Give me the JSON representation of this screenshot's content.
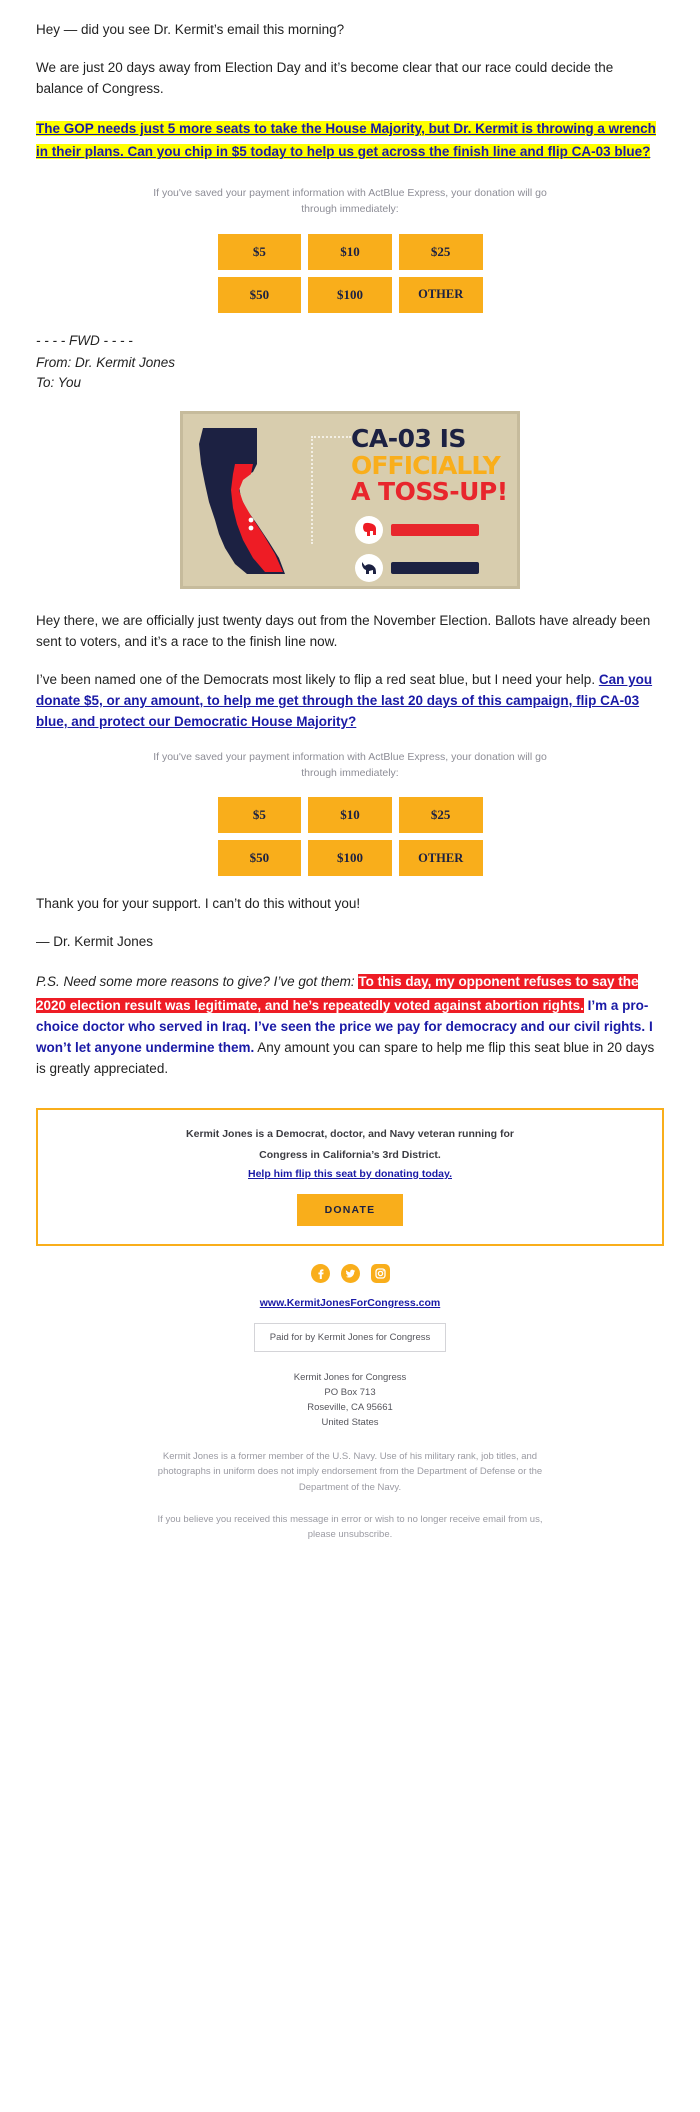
{
  "colors": {
    "highlight_yellow": "#ffff00",
    "link_blue": "#1a1aa6",
    "donate_orange": "#f9ae1b",
    "alert_red": "#ee1c25",
    "navy": "#1c2142",
    "graphic_bg": "#d8cdae"
  },
  "intro": {
    "p1": "Hey — did you see Dr. Kermit’s email this morning?",
    "p2": "We are just 20 days away from Election Day and it’s become clear that our race could decide the balance of Congress.",
    "highlight_link": "The GOP needs just 5 more seats to take the House Majority, but Dr. Kermit is throwing a wrench in their plans. Can you chip in $5 today to help us get across the finish line and flip CA-03 blue?"
  },
  "express_note": "If you've saved your payment information with ActBlue Express, your donation will go through immediately:",
  "donation_buttons": {
    "row1": [
      "$5",
      "$10",
      "$25"
    ],
    "row2": [
      "$50",
      "$100",
      "OTHER"
    ]
  },
  "forward": {
    "divider": "- - - - FWD - - - -",
    "from_label": "From: Dr. Kermit Jones",
    "to_label": "To: You"
  },
  "graphic": {
    "alt_name": "ca-03-toss-up-graphic",
    "line1": "CA-03 IS",
    "line2": "OFFICIALLY",
    "line3": "A TOSS-UP!",
    "party_rep": "republican-elephant-icon",
    "party_dem": "democrat-donkey-icon",
    "bar_rep_label": "Republican",
    "bar_dem_label": "Democrat"
  },
  "fwd_body": {
    "p1": "Hey there, we are officially just twenty days out from the November Election. Ballots have already been sent to voters, and it’s a race to the finish line now.",
    "p2_lead": "I’ve been named one of the Democrats most likely to flip a red seat blue, but I need your help. ",
    "p2_link": "Can you donate $5, or any amount, to help me get through the last 20 days of this campaign, flip CA-03 blue, and protect our Democratic House Majority?",
    "thanks": "Thank you for your support. I can’t do this without you!",
    "signature": "— Dr. Kermit Jones"
  },
  "ps": {
    "lead": "P.S. Need some more reasons to give? I’ve got them: ",
    "red_highlight": "To this day, my opponent refuses to say the 2020 election result was legitimate, and he’s repeatedly voted against abortion rights.",
    "blue_bold": " I’m a pro-choice doctor who served in Iraq. I’ve seen the price we pay for democracy and our civil rights. I won’t let anyone undermine them.",
    "tail": " Any amount you can spare to help me flip this seat blue in 20 days is greatly appreciated."
  },
  "bio_box": {
    "line1": "Kermit Jones is a Democrat, doctor, and Navy veteran running for",
    "line2": "Congress in California’s 3rd District.",
    "link": "Help him flip this seat by donating today.",
    "cta": "DONATE"
  },
  "social": [
    {
      "name": "facebook-icon",
      "glyph": "f"
    },
    {
      "name": "twitter-icon",
      "glyph": "✓"
    },
    {
      "name": "instagram-icon",
      "glyph": "▣"
    }
  ],
  "footer": {
    "website": "www.KermitJonesForCongress.com",
    "paid_for": "Paid for by Kermit Jones for Congress",
    "address_l1": "Kermit Jones for Congress",
    "address_l2": "PO Box 713",
    "address_l3": "Roseville, CA 95661",
    "address_l4": "United States",
    "disclaimer": "Kermit Jones is a former member of the U.S. Navy. Use of his military rank, job titles, and photographs in uniform does not imply endorsement from the Department of Defense or the Department of the Navy.",
    "unsubscribe": "If you believe you received this message in error or wish to no longer receive email from us, please unsubscribe."
  }
}
